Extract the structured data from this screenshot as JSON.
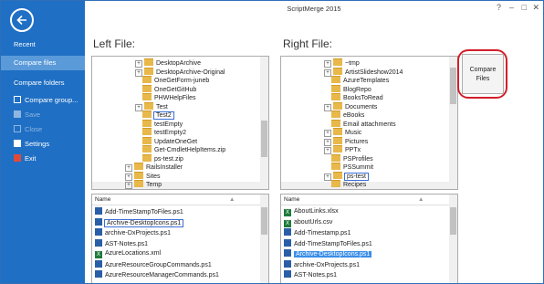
{
  "app": {
    "title": "ScriptMerge 2015"
  },
  "sidebar": {
    "items": [
      {
        "label": "Recent",
        "state": "normal"
      },
      {
        "label": "Compare files",
        "state": "selected"
      },
      {
        "label": "Compare folders",
        "state": "normal"
      },
      {
        "label": "Compare group...",
        "state": "normal",
        "icon": "compare-group-icon"
      },
      {
        "label": "Save",
        "state": "disabled",
        "icon": "save-icon"
      },
      {
        "label": "Close",
        "state": "disabled",
        "icon": "close-icon"
      },
      {
        "label": "Settings",
        "state": "normal",
        "icon": "settings-icon"
      },
      {
        "label": "Exit",
        "state": "normal",
        "icon": "exit-icon"
      }
    ]
  },
  "left": {
    "heading": "Left File:",
    "tree": [
      {
        "label": "DesktopArchive",
        "exp": "+",
        "kind": "folder"
      },
      {
        "label": "DesktopArchive-Original",
        "exp": "+",
        "kind": "folder"
      },
      {
        "label": "OneGetForm-juneb",
        "exp": "",
        "kind": "folder"
      },
      {
        "label": "OneGetGitHub",
        "exp": "",
        "kind": "folder"
      },
      {
        "label": "PHWHelpFiles",
        "exp": "",
        "kind": "folder"
      },
      {
        "label": "Test",
        "exp": "+",
        "kind": "folder"
      },
      {
        "label": "Test2",
        "exp": "",
        "kind": "folder",
        "boxed": true
      },
      {
        "label": "testEmpty",
        "exp": "",
        "kind": "folder"
      },
      {
        "label": "testEmpty2",
        "exp": "",
        "kind": "folder"
      },
      {
        "label": "UpdateOneGet",
        "exp": "",
        "kind": "folder"
      },
      {
        "label": "Get-CmdletHelpItems.zip",
        "exp": "",
        "kind": "folder"
      },
      {
        "label": "ps-test.zip",
        "exp": "",
        "kind": "folder"
      },
      {
        "label": "RailsInstaller",
        "exp": "+",
        "kind": "folder",
        "indent": 0
      },
      {
        "label": "Sites",
        "exp": "+",
        "kind": "folder",
        "indent": 0
      },
      {
        "label": "Temp",
        "exp": "+",
        "kind": "folder",
        "indent": 0
      }
    ],
    "list_header": "Name",
    "files": [
      {
        "label": "Add-TimeStampToFiles.ps1",
        "kind": "ps"
      },
      {
        "label": "Archive-DesktopIcons.ps1",
        "kind": "ps",
        "boxed": true
      },
      {
        "label": "archive-DxProjects.ps1",
        "kind": "ps"
      },
      {
        "label": "AST-Notes.ps1",
        "kind": "ps"
      },
      {
        "label": "AzureLocations.xml",
        "kind": "xl"
      },
      {
        "label": "AzureResourceGroupCommands.ps1",
        "kind": "ps"
      },
      {
        "label": "AzureResourceManagerCommands.ps1",
        "kind": "ps"
      }
    ]
  },
  "right": {
    "heading": "Right File:",
    "tree": [
      {
        "label": "~tmp",
        "exp": "+",
        "kind": "folder"
      },
      {
        "label": "ArtistSlideshow2014",
        "exp": "+",
        "kind": "folder"
      },
      {
        "label": "AzureTemplates",
        "exp": "",
        "kind": "folder"
      },
      {
        "label": "BlogRepo",
        "exp": "",
        "kind": "folder"
      },
      {
        "label": "BooksToRead",
        "exp": "",
        "kind": "folder"
      },
      {
        "label": "Documents",
        "exp": "+",
        "kind": "folder"
      },
      {
        "label": "eBooks",
        "exp": "",
        "kind": "folder"
      },
      {
        "label": "Email attachments",
        "exp": "",
        "kind": "folder"
      },
      {
        "label": "Music",
        "exp": "+",
        "kind": "folder"
      },
      {
        "label": "Pictures",
        "exp": "+",
        "kind": "folder"
      },
      {
        "label": "PPTx",
        "exp": "+",
        "kind": "folder"
      },
      {
        "label": "PSProfiles",
        "exp": "",
        "kind": "folder"
      },
      {
        "label": "PSSummit",
        "exp": "",
        "kind": "folder"
      },
      {
        "label": "ps-test",
        "exp": "+",
        "kind": "folder",
        "boxed": true
      },
      {
        "label": "Recipes",
        "exp": "",
        "kind": "folder"
      }
    ],
    "list_header": "Name",
    "files": [
      {
        "label": "AboutLinks.xlsx",
        "kind": "xl"
      },
      {
        "label": "aboutUrls.csv",
        "kind": "xl"
      },
      {
        "label": "Add-Timestamp.ps1",
        "kind": "ps"
      },
      {
        "label": "Add-TimeStampToFiles.ps1",
        "kind": "ps"
      },
      {
        "label": "Archive-DesktopIcons.ps1",
        "kind": "ps",
        "selected": true
      },
      {
        "label": "archive-DxProjects.ps1",
        "kind": "ps"
      },
      {
        "label": "AST-Notes.ps1",
        "kind": "ps"
      }
    ]
  },
  "compare_button": {
    "line1": "Compare",
    "line2": "Files"
  },
  "colors": {
    "sidebar": "#1f6fc4",
    "selected_nav": "#5a9ad9",
    "highlight": "#3b8ee8",
    "callout": "#d21f2a"
  }
}
